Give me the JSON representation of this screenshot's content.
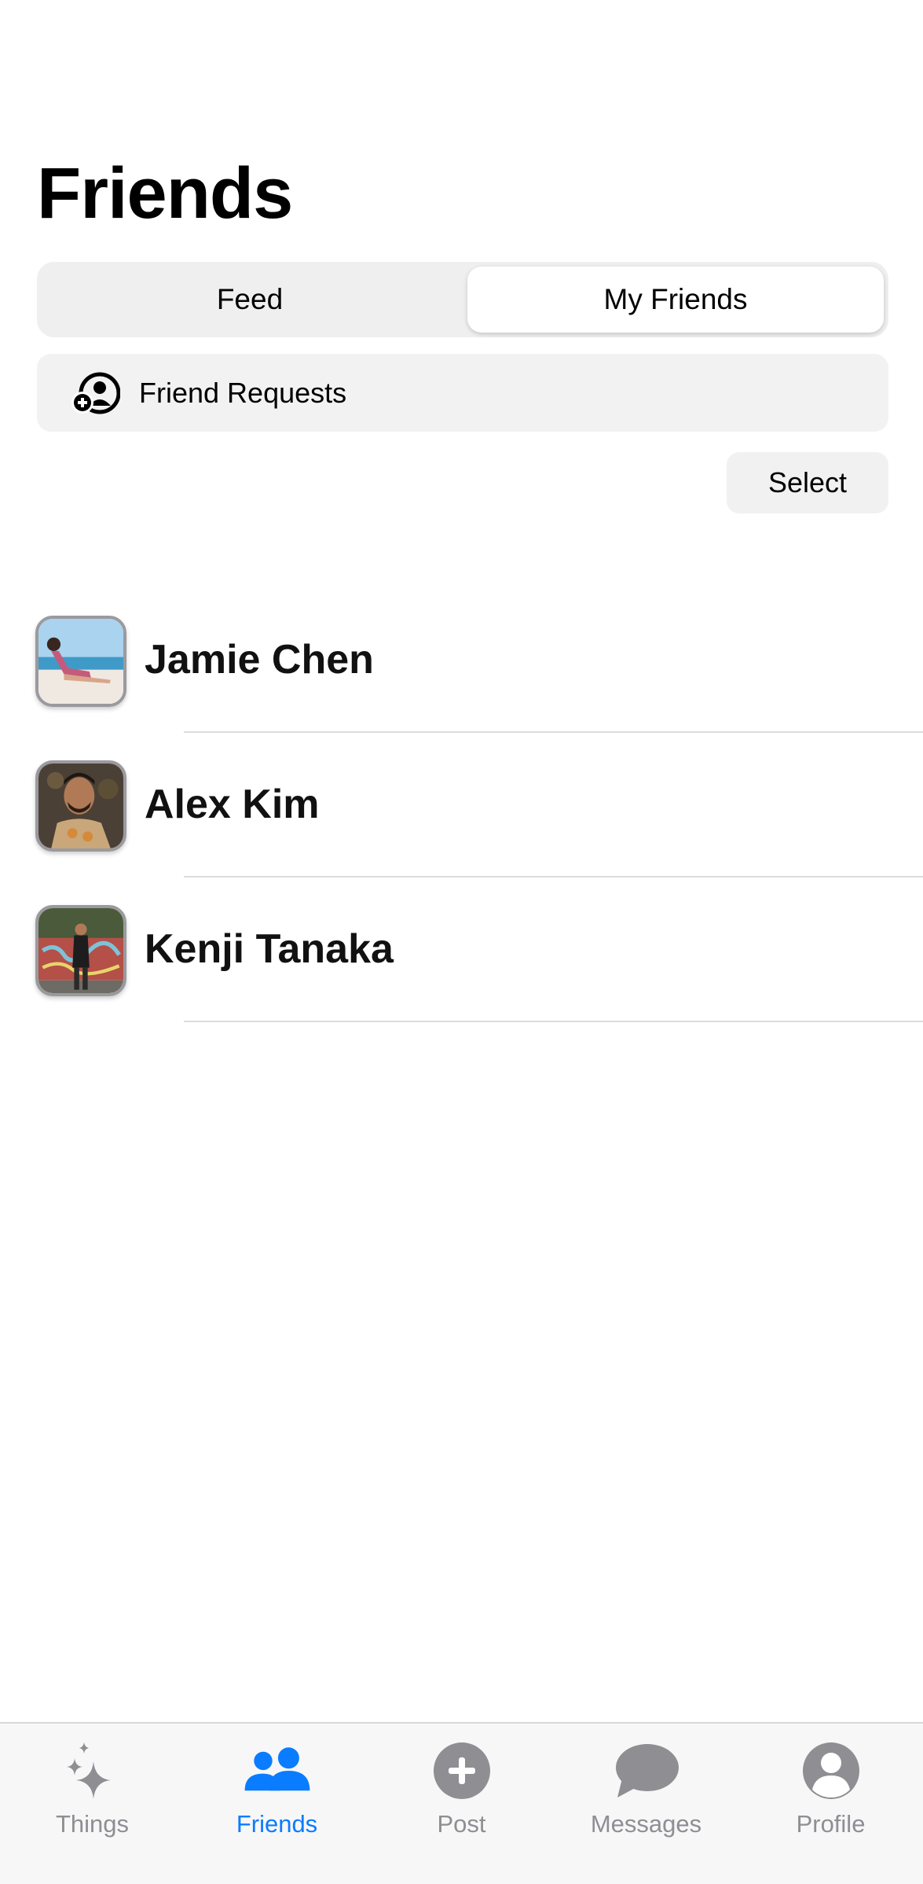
{
  "header": {
    "title": "Friends"
  },
  "segmented": {
    "options": [
      "Feed",
      "My Friends"
    ],
    "selected": "My Friends"
  },
  "requests": {
    "label": "Friend Requests",
    "icon": "person-add-icon"
  },
  "toolbar": {
    "select_label": "Select"
  },
  "friends": [
    {
      "name": "Jamie Chen"
    },
    {
      "name": "Alex Kim"
    },
    {
      "name": "Kenji Tanaka"
    }
  ],
  "tabbar": {
    "items": [
      {
        "label": "Things",
        "icon": "sparkles-icon"
      },
      {
        "label": "Friends",
        "icon": "people-icon"
      },
      {
        "label": "Post",
        "icon": "plus-circle-icon"
      },
      {
        "label": "Messages",
        "icon": "chat-bubble-icon"
      },
      {
        "label": "Profile",
        "icon": "person-circle-icon"
      }
    ],
    "active": "Friends"
  },
  "colors": {
    "accent": "#0a7cff",
    "inactive": "#8e8e93"
  }
}
